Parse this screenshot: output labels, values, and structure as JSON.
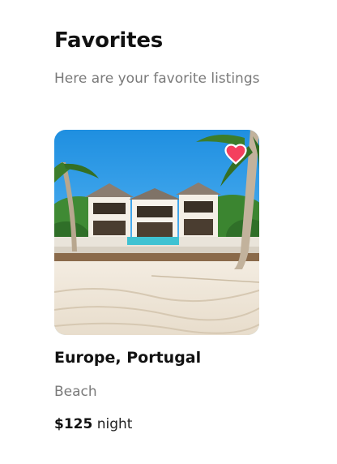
{
  "page": {
    "title": "Favorites",
    "subtitle": "Here are your favorite listings"
  },
  "listings": [
    {
      "location": "Europe, Portugal",
      "category": "Beach",
      "price": "$125",
      "price_unit": "night",
      "favorited": true,
      "favorite_icon": "heart-icon",
      "favorite_color": "#f43f5e",
      "image_subject": "beach-villa-photo"
    }
  ]
}
